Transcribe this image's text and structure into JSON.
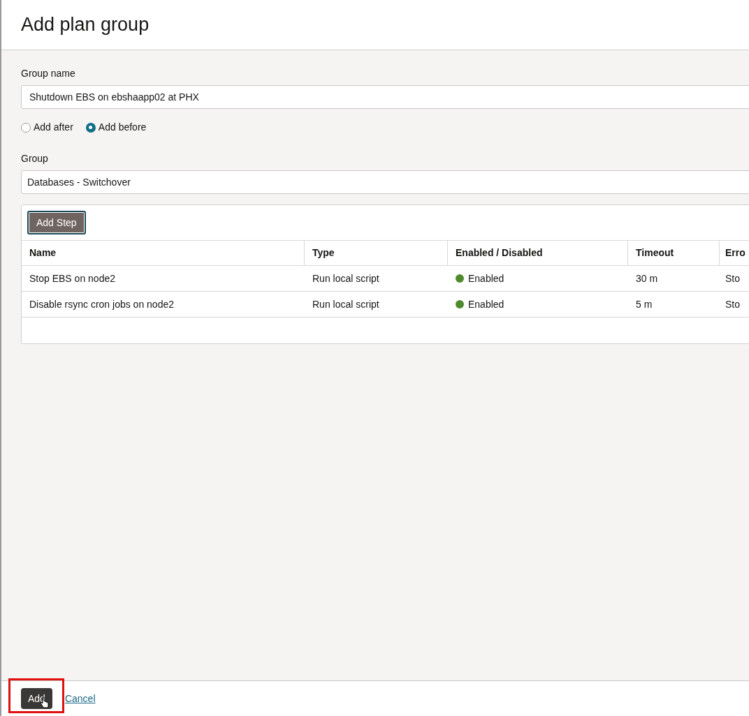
{
  "dialog": {
    "title": "Add plan group"
  },
  "group_name": {
    "label": "Group name",
    "value": "Shutdown EBS on ebshaapp02 at PHX"
  },
  "position": [
    {
      "label": "Add after",
      "selected": false
    },
    {
      "label": "Add before",
      "selected": true
    }
  ],
  "group": {
    "label": "Group",
    "value": "Databases - Switchover"
  },
  "steps": {
    "add_button": "Add Step",
    "columns": [
      "Name",
      "Type",
      "Enabled / Disabled",
      "Timeout",
      "Erro"
    ],
    "rows": [
      {
        "name": "Stop EBS on node2",
        "type": "Run local script",
        "enabled": true,
        "status": "Enabled",
        "timeout": "30 m",
        "column_5": "Sto"
      },
      {
        "name": "Disable rsync cron jobs on node2",
        "type": "Run local script",
        "enabled": true,
        "status": "Enabled",
        "timeout": "5 m",
        "column_5": "Sto"
      }
    ]
  },
  "footer": {
    "primary": "Add",
    "cancel": "Cancel"
  }
}
